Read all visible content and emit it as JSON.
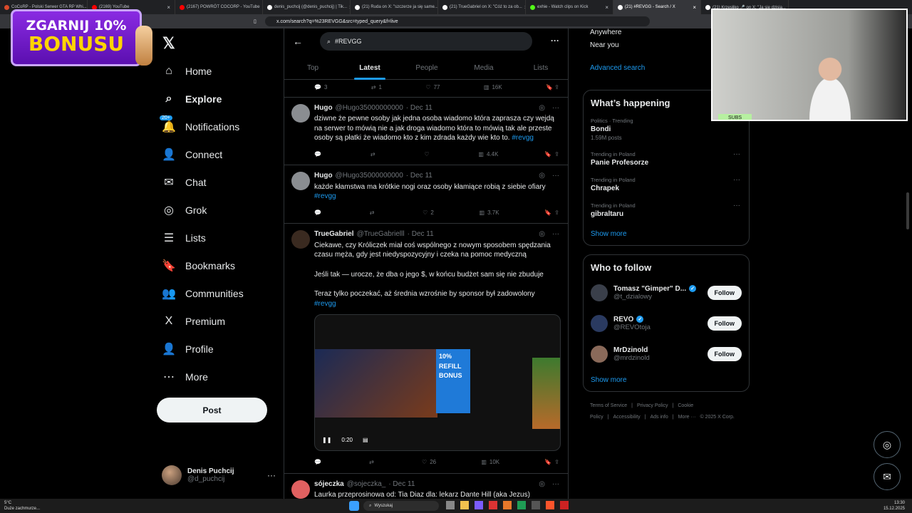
{
  "browser": {
    "tabs": [
      {
        "label": "CoCoRP - Polski Serwer GTA RP Whi...",
        "color": "#d94a2b"
      },
      {
        "label": "(2169) YouTube",
        "color": "#ff0000"
      },
      {
        "label": "(2167) POWRÓT COCORP - YouTube",
        "color": "#ff0000"
      },
      {
        "label": "denis_puchcij (@denis_puchcij) | Tik...",
        "color": "#ffffff"
      },
      {
        "label": "(21) Ruda on X: \"szczerze ja się same...",
        "color": "#ffffff"
      },
      {
        "label": "(21) TrueGabriel on X: \"Cóż to za ob...",
        "color": "#ffffff"
      },
      {
        "label": "exhie - Watch clips on Kick",
        "color": "#53fc18"
      },
      {
        "label": "(21) #REVGG - Search / X",
        "color": "#ffffff",
        "active": true
      },
      {
        "label": "(21) Krzesłiko 🎤 on X: \"Ja się dzisia...",
        "color": "#ffffff"
      }
    ],
    "url": "x.com/search?q=%23REVGG&src=typed_query&f=live"
  },
  "banner": {
    "line1": "ZGARNIJ 10%",
    "line2": "BONUSU"
  },
  "nav": {
    "items": [
      {
        "label": "Home",
        "icon": "⌂"
      },
      {
        "label": "Explore",
        "icon": "⌕",
        "bold": true
      },
      {
        "label": "Notifications",
        "icon": "🔔",
        "badge": "20+"
      },
      {
        "label": "Connect",
        "icon": "👤"
      },
      {
        "label": "Chat",
        "icon": "✉"
      },
      {
        "label": "Grok",
        "icon": "◎"
      },
      {
        "label": "Lists",
        "icon": "☰"
      },
      {
        "label": "Bookmarks",
        "icon": "🔖"
      },
      {
        "label": "Communities",
        "icon": "👥"
      },
      {
        "label": "Premium",
        "icon": "X"
      },
      {
        "label": "Profile",
        "icon": "👤"
      },
      {
        "label": "More",
        "icon": "⋯"
      }
    ],
    "post": "Post",
    "account": {
      "name": "Denis Puchcij",
      "handle": "@d_puchcij"
    }
  },
  "main": {
    "search_value": "#REVGG",
    "tabs": [
      "Top",
      "Latest",
      "People",
      "Media",
      "Lists"
    ],
    "active_tab": "Latest",
    "top_actions": {
      "reply": "3",
      "repost": "1",
      "like": "77",
      "views": "16K"
    },
    "tweets": [
      {
        "name": "Hugo",
        "handle": "@Hugo35000000000",
        "date": "· Dec 11",
        "text": "dziwne że pewne osoby jak jedna osoba wiadomo która zaprasza czy wejdą na serwer to mówią nie a jak droga wiadomo która to mówią tak ale przeste osoby są płatki że wiadomo kto z kim zdrada każdy wie kto to.",
        "tag": "#revgg",
        "reply": "",
        "repost": "",
        "like": "",
        "views": "4.4K"
      },
      {
        "name": "Hugo",
        "handle": "@Hugo35000000000",
        "date": "· Dec 11",
        "text": "każde kłamstwa ma krótkie nogi oraz osoby kłamiące robią z siebie ofiary",
        "tag": "#revgg",
        "reply": "",
        "repost": "",
        "like": "2",
        "views": "3.7K"
      },
      {
        "name": "TrueGabriel",
        "handle": "@TrueGabrielll",
        "date": "· Dec 11",
        "p1": "Ciekawe, czy Króliczek miał coś wspólnego z nowym sposobem spędzania czasu męża, gdy jest niedyspozycyjny i czeka na pomoc medyczną",
        "p2": "Jeśli tak — urocze, że dba o jego $, w końcu budżet sam się nie zbuduje",
        "p3": "Teraz tylko poczekać, aż średnia wzrośnie by sponsor był zadowolony",
        "tag": "#revgg",
        "media_text": "10% REFILL BONUS",
        "video_time": "0:20",
        "reply": "",
        "repost": "",
        "like": "26",
        "views": "10K"
      },
      {
        "name": "sójeczka",
        "handle": "@sojeczka_",
        "date": "· Dec 11",
        "text": "Laurka przeprosinowa od: Tia Diaz dla: lekarz Dante Hill (aka Jezus)"
      }
    ]
  },
  "rail": {
    "filters": [
      "Anywhere",
      "Near you"
    ],
    "advanced": "Advanced search",
    "happening_title": "What’s happening",
    "trends": [
      {
        "ctx": "Politics · Trending",
        "title": "Bondi",
        "count": "1.59M posts"
      },
      {
        "ctx": "Trending in Poland",
        "title": "Panie Profesorze",
        "count": ""
      },
      {
        "ctx": "Trending in Poland",
        "title": "Chrapek",
        "count": ""
      },
      {
        "ctx": "Trending in Poland",
        "title": "gibraltaru",
        "count": ""
      }
    ],
    "show_more": "Show more",
    "who_title": "Who to follow",
    "who": [
      {
        "name": "Tomasz \"Gimper\" D...",
        "handle": "@t_dzialowy",
        "verified": true
      },
      {
        "name": "REVO",
        "handle": "@REVOtoja",
        "verified": true
      },
      {
        "name": "MrDzinold",
        "handle": "@mrdzinold",
        "verified": false
      }
    ],
    "follow": "Follow",
    "footer": [
      "Terms of Service",
      "|",
      "Privacy Policy",
      "|",
      "Cookie Policy",
      "|",
      "Accessibility",
      "|",
      "Ads info",
      "|",
      "More ···",
      "© 2025 X Corp."
    ]
  },
  "cam": {
    "subs": "SUBS"
  },
  "taskbar": {
    "weather_temp": "5°C",
    "weather_desc": "Duże zachmurze...",
    "search": "Wyszukaj",
    "time": "13:30",
    "date": "15.12.2025"
  }
}
